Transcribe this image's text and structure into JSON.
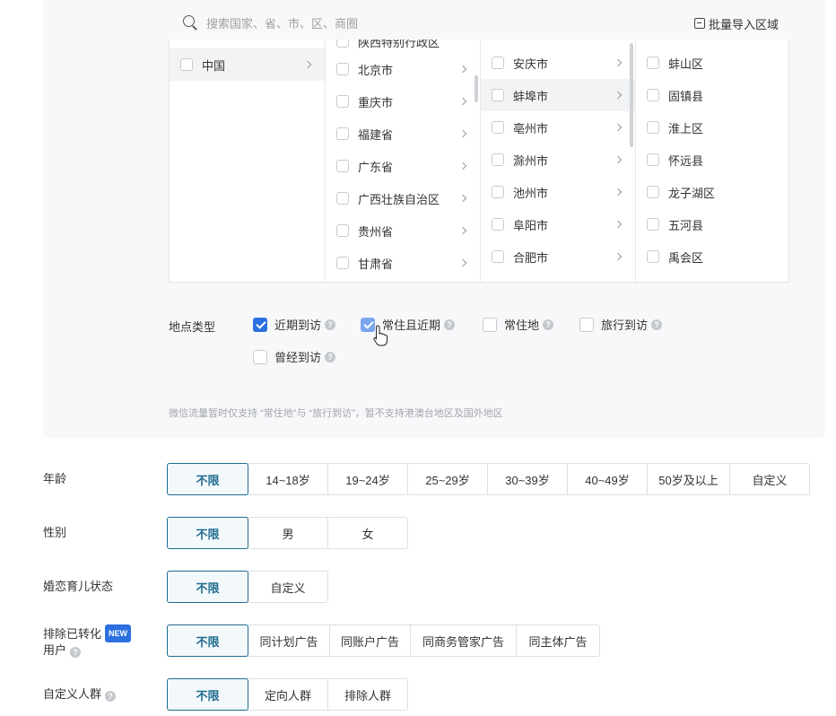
{
  "search": {
    "placeholder": "搜索国家、省、市、区、商圈",
    "import_label": "批量导入区域"
  },
  "cascader": {
    "col1": [
      {
        "label": "中国",
        "active": true
      }
    ],
    "col2_partial": "陕西特别行政区",
    "col2": [
      "北京市",
      "重庆市",
      "福建省",
      "广东省",
      "广西壮族自治区",
      "贵州省",
      "甘肃省"
    ],
    "col3": [
      "安庆市",
      "蚌埠市",
      "亳州市",
      "滁州市",
      "池州市",
      "阜阳市",
      "合肥市"
    ],
    "col3_active": "蚌埠市",
    "col4": [
      "蚌山区",
      "固镇县",
      "淮上区",
      "怀远县",
      "龙子湖区",
      "五河县",
      "禹会区"
    ]
  },
  "location_type": {
    "label": "地点类型",
    "options": [
      {
        "label": "近期到访",
        "state": "checked"
      },
      {
        "label": "常住且近期",
        "state": "hover"
      },
      {
        "label": "常住地",
        "state": "unchecked"
      },
      {
        "label": "旅行到访",
        "state": "unchecked"
      },
      {
        "label": "曾经到访",
        "state": "unchecked"
      }
    ],
    "note": "微信流量暂时仅支持 “常住地”与 “旅行到访”，暂不支持港澳台地区及国外地区"
  },
  "age": {
    "label": "年龄",
    "options": [
      "不限",
      "14~18岁",
      "19~24岁",
      "25~29岁",
      "30~39岁",
      "40~49岁",
      "50岁及以上",
      "自定义"
    ],
    "selected": "不限"
  },
  "gender": {
    "label": "性别",
    "options": [
      "不限",
      "男",
      "女"
    ],
    "selected": "不限"
  },
  "marital": {
    "label": "婚恋育儿状态",
    "options": [
      "不限",
      "自定义"
    ],
    "selected": "不限"
  },
  "exclude": {
    "label_line1": "排除已转化",
    "badge": "NEW",
    "label_line2": "用户",
    "options": [
      "不限",
      "同计划广告",
      "同账户广告",
      "同商务管家广告",
      "同主体广告"
    ],
    "selected": "不限"
  },
  "custom_audience": {
    "label": "自定义人群",
    "options": [
      "不限",
      "定向人群",
      "排除人群"
    ],
    "selected": "不限"
  },
  "colors": {
    "accent": "#2b6fe0",
    "selected_border": "#1f6b8f"
  }
}
